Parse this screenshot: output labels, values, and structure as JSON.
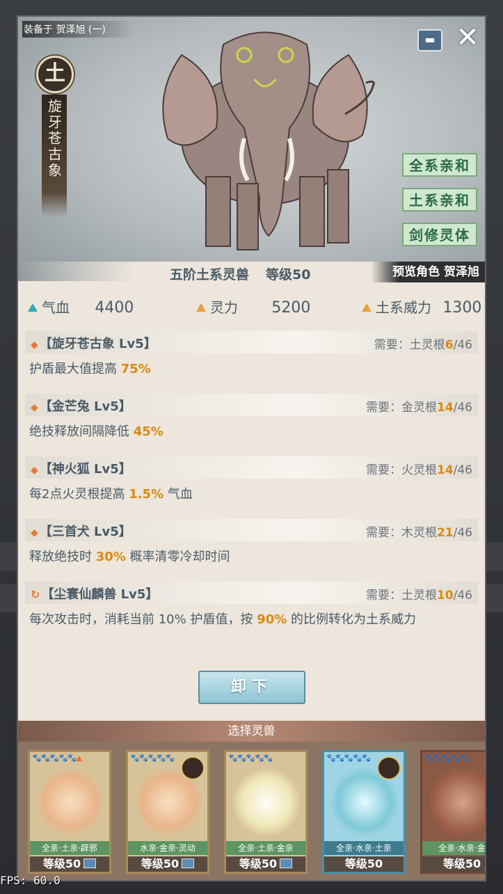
{
  "equipped_to": "装备于 贺泽旭 (一)",
  "element": "土",
  "beast_name": "旋牙苍古象",
  "tags": [
    "全系亲和",
    "土系亲和",
    "剑修灵体"
  ],
  "rank_text": "五阶土系灵兽",
  "level_text": "等级50",
  "preview_text": "预览角色 贺泽旭",
  "stats": [
    {
      "label": "气血",
      "value": "4400",
      "color": "#2fa8b8"
    },
    {
      "label": "灵力",
      "value": "5200",
      "color": "#e8a13a"
    },
    {
      "label": "土系威力",
      "value": "1300",
      "color": "#e8a13a"
    }
  ],
  "skills": [
    {
      "title": "【旋牙苍古象 Lv5】",
      "icon": "diamond",
      "req_label": "需要：",
      "req_type": "土灵根",
      "req_cur": "6",
      "req_max": "/46",
      "desc_pre": "护盾最大值提高 ",
      "desc_hl": "75%",
      "desc_post": ""
    },
    {
      "title": "【金芒兔 Lv5】",
      "icon": "diamond",
      "req_label": "需要：",
      "req_type": "金灵根",
      "req_cur": "14",
      "req_max": "/46",
      "desc_pre": "绝技释放间隔降低 ",
      "desc_hl": "45%",
      "desc_post": ""
    },
    {
      "title": "【神火狐 Lv5】",
      "icon": "diamond",
      "req_label": "需要：",
      "req_type": "火灵根",
      "req_cur": "14",
      "req_max": "/46",
      "desc_pre": "每2点火灵根提高 ",
      "desc_hl": "1.5%",
      "desc_post": " 气血"
    },
    {
      "title": "【三首犬 Lv5】",
      "icon": "diamond",
      "req_label": "需要：",
      "req_type": "木灵根",
      "req_cur": "21",
      "req_max": "/46",
      "desc_pre": "释放绝技时 ",
      "desc_hl": "30%",
      "desc_post": " 概率清零冷却时间"
    },
    {
      "title": "【尘寰仙麟兽 Lv5】",
      "icon": "cycle",
      "req_label": "需要：",
      "req_type": "土灵根",
      "req_cur": "10",
      "req_max": "/46",
      "desc_pre": "每次攻击时，消耗当前 10% 护盾值，按 ",
      "desc_hl": "90%",
      "desc_post": " 的比例转化为土系威力"
    }
  ],
  "unequip_label": "卸下",
  "select_title": "选择灵兽",
  "cards": [
    {
      "stars": "🐾🐾🐾🐾🐾▲",
      "trait": "全亲·土亲·辟邪",
      "level": "等级50",
      "style": "tan",
      "avatar": false
    },
    {
      "stars": "🐾🐾🐾🐾🐾",
      "trait": "水亲·金亲·灵动",
      "level": "等级50",
      "style": "tan",
      "avatar": true
    },
    {
      "stars": "🐾🐾🐾🐾🐾",
      "trait": "全亲·土亲·金亲",
      "level": "等级50",
      "style": "gold",
      "avatar": false
    },
    {
      "stars": "🐾🐾🐾🐾🐾",
      "trait": "全亲·水亲·土亲",
      "level": "等级50",
      "style": "blue",
      "avatar": true
    },
    {
      "stars": "🐾🐾🐾🐾🐾",
      "trait": "全亲·水亲·金",
      "level": "等级50",
      "style": "dark",
      "avatar": false
    }
  ],
  "fps": "FPS: 60.0"
}
